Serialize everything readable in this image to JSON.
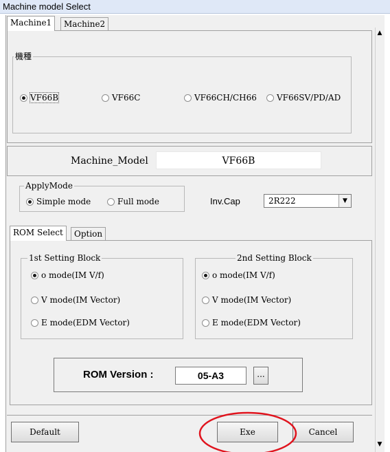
{
  "window": {
    "title": "Machine model Select"
  },
  "top_tabs": [
    "Machine1",
    "Machine2"
  ],
  "machine_group": {
    "legend": "機種",
    "options": [
      {
        "label": "VF66B",
        "checked": true
      },
      {
        "label": "VF66C",
        "checked": false
      },
      {
        "label": "VF66CH/CH66",
        "checked": false
      },
      {
        "label": "VF66SV/PD/AD",
        "checked": false
      }
    ]
  },
  "machine_model": {
    "label": "Machine_Model",
    "value": "VF66B"
  },
  "apply_mode": {
    "legend": "ApplyMode",
    "options": [
      {
        "label": "Simple mode",
        "checked": true
      },
      {
        "label": "Full mode",
        "checked": false
      }
    ]
  },
  "inv_cap": {
    "label": "Inv.Cap",
    "value": "2R222"
  },
  "rom_tabs": [
    "ROM Select",
    "Option"
  ],
  "setting_block_1": {
    "legend": "1st Setting Block",
    "options": [
      {
        "label": "o mode(IM V/f)",
        "checked": true
      },
      {
        "label": "V mode(IM Vector)",
        "checked": false
      },
      {
        "label": "E mode(EDM Vector)",
        "checked": false
      }
    ]
  },
  "setting_block_2": {
    "legend": "2nd Setting Block",
    "options": [
      {
        "label": "o mode(IM V/f)",
        "checked": true
      },
      {
        "label": "V mode(IM Vector)",
        "checked": false
      },
      {
        "label": "E mode(EDM Vector)",
        "checked": false
      }
    ]
  },
  "rom_version": {
    "label": "ROM Version :",
    "value": "05-A3",
    "browse_label": "..."
  },
  "buttons": {
    "default": "Default",
    "exe": "Exe",
    "cancel": "Cancel"
  },
  "scroll": {
    "up": "▲",
    "down": "▼"
  },
  "colors": {
    "highlight_circle": "#e0141e",
    "title_bar": "#dfe8f7"
  }
}
